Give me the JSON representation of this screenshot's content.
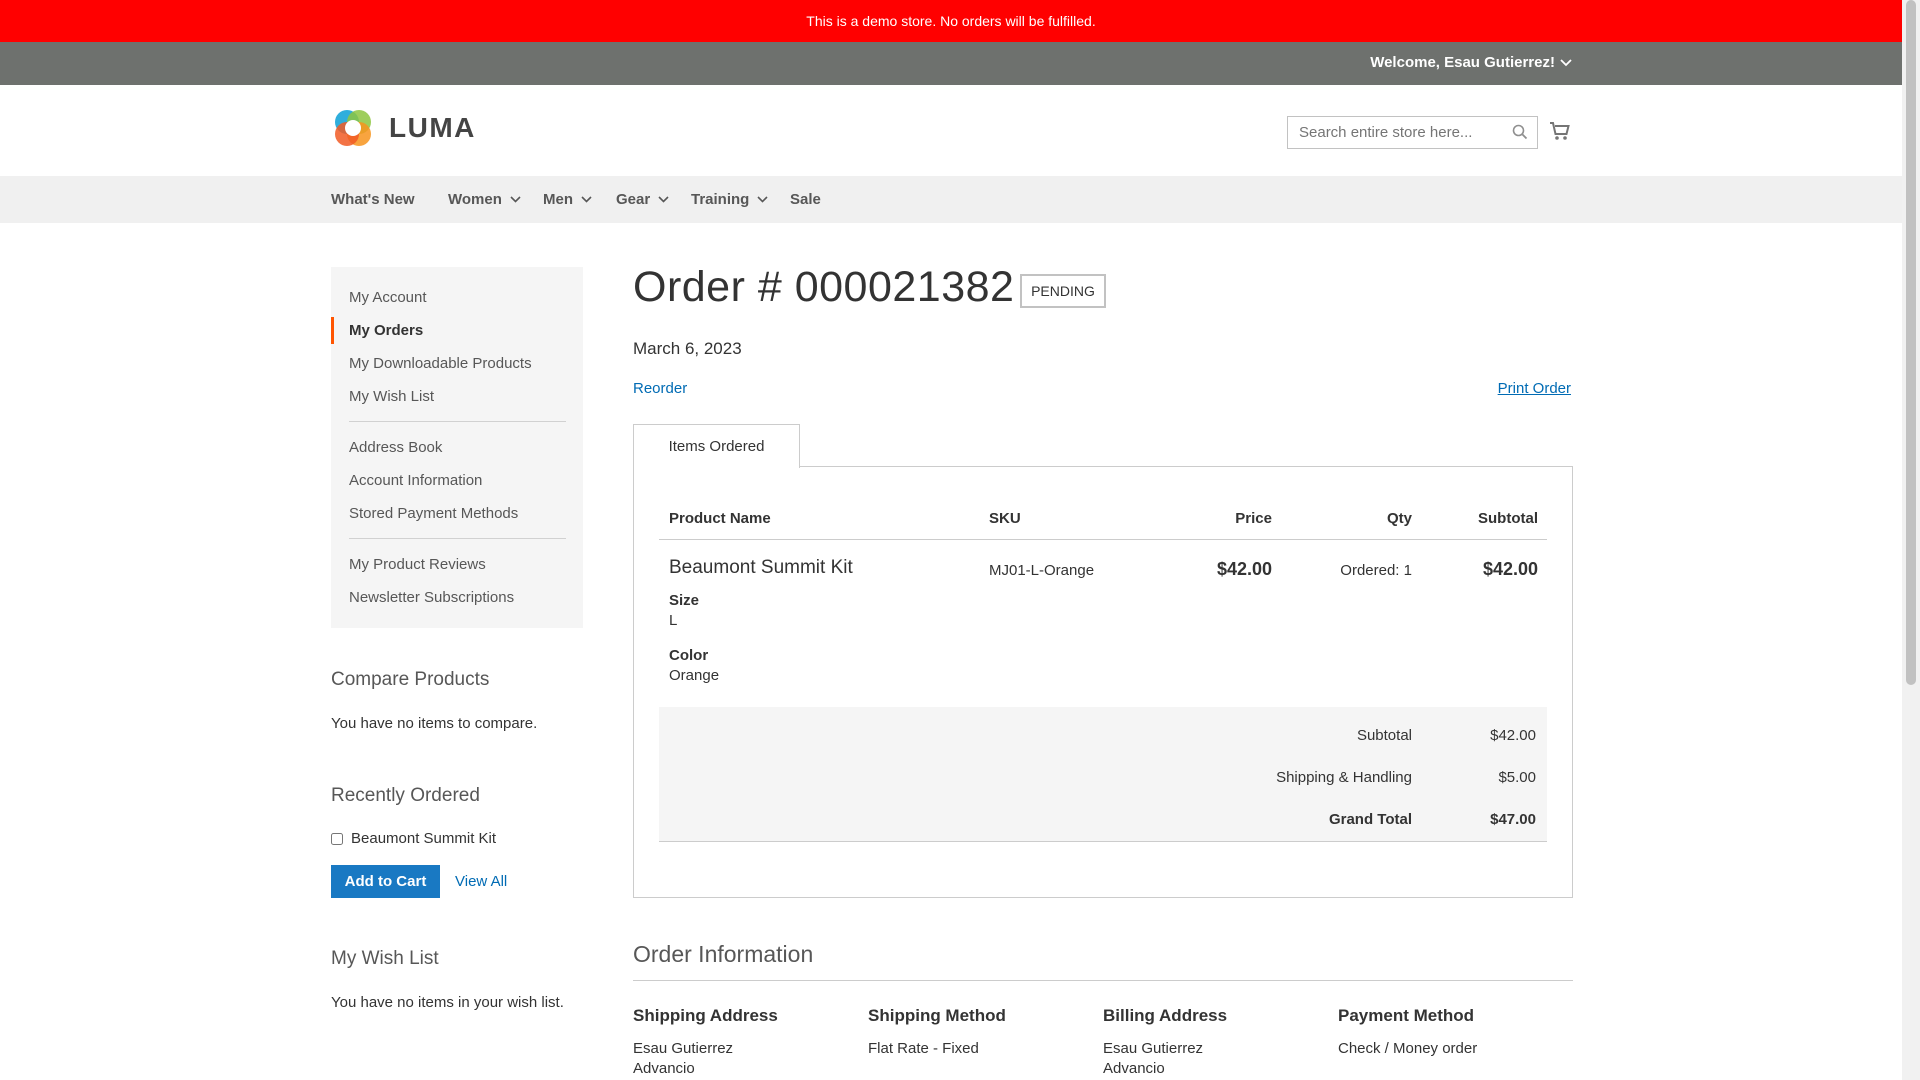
{
  "demo_notice": "This is a demo store. No orders will be fulfilled.",
  "header": {
    "welcome": "Welcome, Esau Gutierrez!"
  },
  "logo": {
    "text": "LUMA"
  },
  "search": {
    "placeholder": "Search entire store here..."
  },
  "nav": [
    {
      "label": "What's New"
    },
    {
      "label": "Women"
    },
    {
      "label": "Men"
    },
    {
      "label": "Gear"
    },
    {
      "label": "Training"
    },
    {
      "label": "Sale"
    }
  ],
  "sidebar": {
    "items": [
      "My Account",
      "My Orders",
      "My Downloadable Products",
      "My Wish List",
      "Address Book",
      "Account Information",
      "Stored Payment Methods",
      "My Product Reviews",
      "Newsletter Subscriptions"
    ],
    "active": "My Orders"
  },
  "compare": {
    "title": "Compare Products",
    "empty": "You have no items to compare."
  },
  "recent": {
    "title": "Recently Ordered",
    "item": "Beaumont Summit Kit",
    "add_to_cart": "Add to Cart",
    "view_all": "View All"
  },
  "wishlist": {
    "title": "My Wish List",
    "empty": "You have no items in your wish list."
  },
  "order": {
    "title": "Order # 000021382",
    "status": "PENDING",
    "date": "March 6, 2023",
    "reorder": "Reorder",
    "print": "Print Order",
    "tab": "Items Ordered",
    "columns": {
      "name": "Product Name",
      "sku": "SKU",
      "price": "Price",
      "qty": "Qty",
      "subtotal": "Subtotal"
    },
    "item": {
      "name": "Beaumont Summit Kit",
      "sku": "MJ01-L-Orange",
      "price": "$42.00",
      "qty": "Ordered: 1",
      "subtotal": "$42.00",
      "options": [
        {
          "label": "Size",
          "value": "L"
        },
        {
          "label": "Color",
          "value": "Orange"
        }
      ]
    },
    "totals": [
      {
        "label": "Subtotal",
        "value": "$42.00"
      },
      {
        "label": "Shipping & Handling",
        "value": "$5.00"
      },
      {
        "label": "Grand Total",
        "value": "$47.00"
      }
    ]
  },
  "order_info": {
    "title": "Order Information",
    "shipping_address": {
      "title": "Shipping Address",
      "lines": [
        "Esau Gutierrez",
        "Advancio"
      ]
    },
    "shipping_method": {
      "title": "Shipping Method",
      "lines": [
        "Flat Rate - Fixed"
      ]
    },
    "billing_address": {
      "title": "Billing Address",
      "lines": [
        "Esau Gutierrez",
        "Advancio"
      ]
    },
    "payment_method": {
      "title": "Payment Method",
      "lines": [
        "Check / Money order"
      ]
    }
  },
  "colors": {
    "demo_bar": "#ff0000",
    "header": "#6e716e",
    "link": "#006bb4",
    "primary": "#1979c3",
    "active_marker": "#ff5501"
  }
}
